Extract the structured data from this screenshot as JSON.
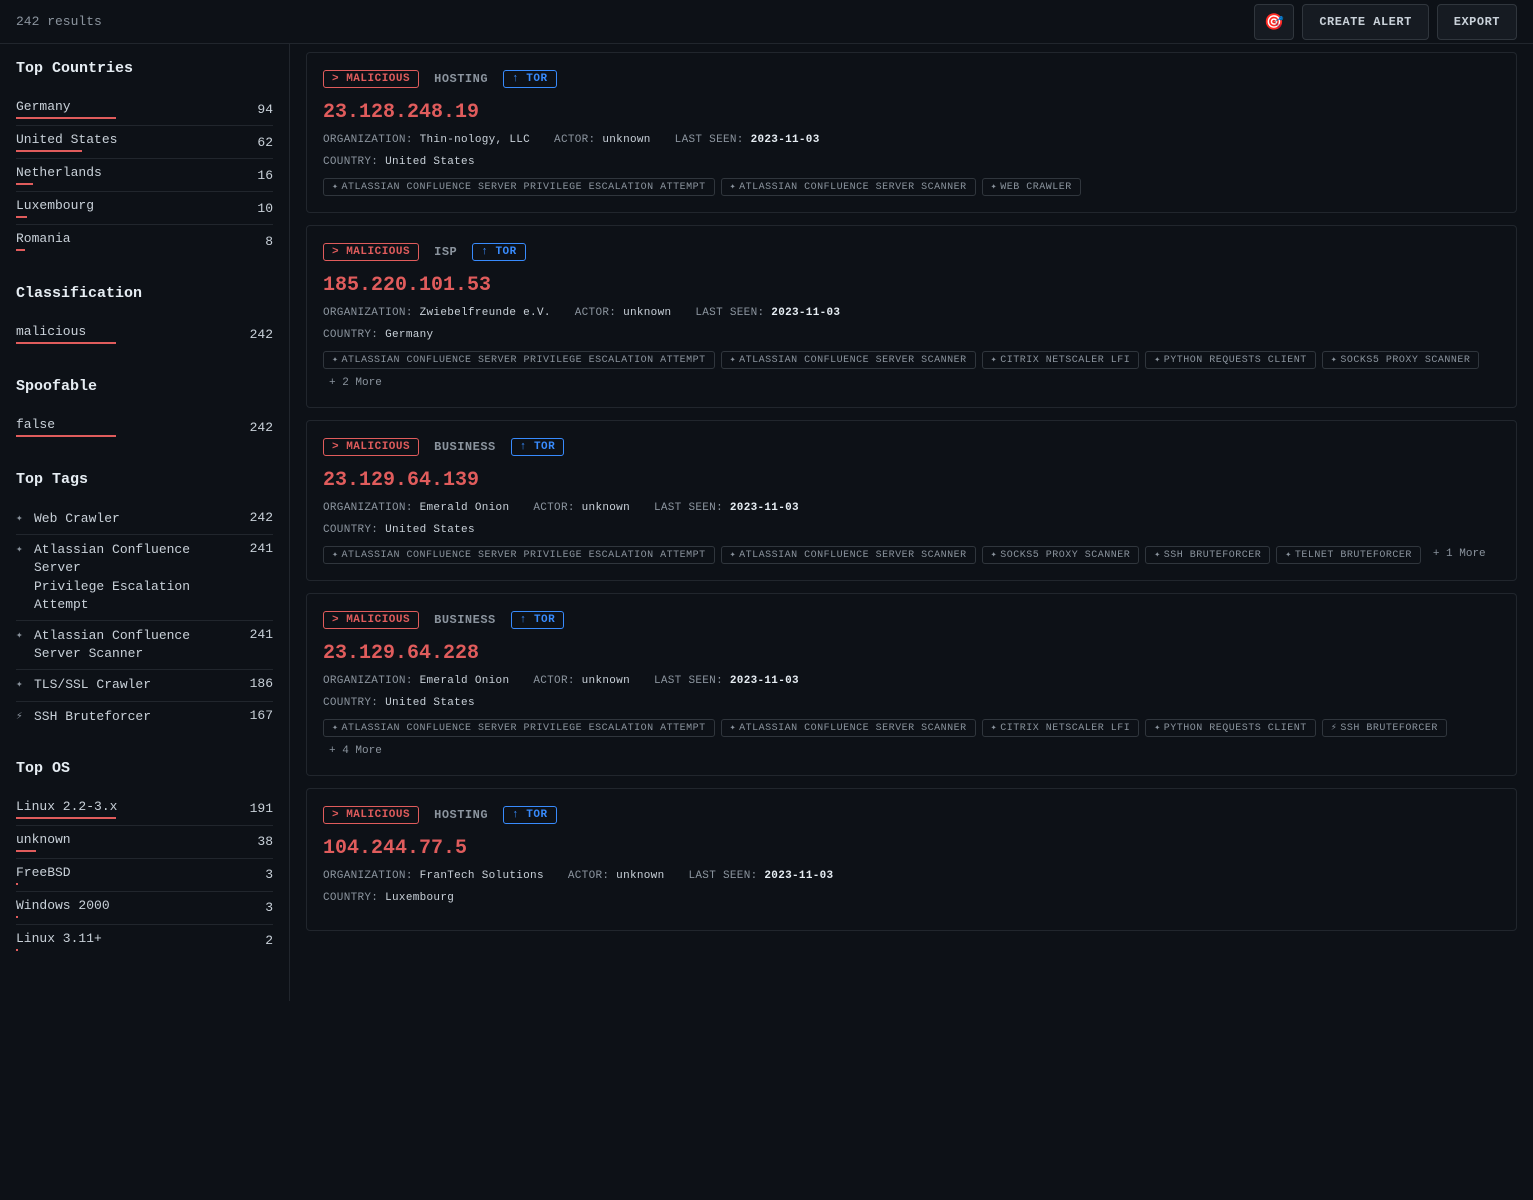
{
  "topbar": {
    "results_count": "242 results",
    "icon": "🎯",
    "create_alert_label": "CREATE ALERT",
    "export_label": "EXPORT"
  },
  "sidebar": {
    "top_countries_title": "Top Countries",
    "countries": [
      {
        "name": "Germany",
        "count": 94,
        "bar_pct": 100
      },
      {
        "name": "United States",
        "count": 62,
        "bar_pct": 66
      },
      {
        "name": "Netherlands",
        "count": 16,
        "bar_pct": 17
      },
      {
        "name": "Luxembourg",
        "count": 10,
        "bar_pct": 11
      },
      {
        "name": "Romania",
        "count": 8,
        "bar_pct": 9
      }
    ],
    "classification_title": "Classification",
    "classifications": [
      {
        "name": "malicious",
        "count": 242,
        "bar_pct": 100
      }
    ],
    "spoofable_title": "Spoofable",
    "spoofables": [
      {
        "name": "false",
        "count": 242,
        "bar_pct": 100
      }
    ],
    "top_tags_title": "Top Tags",
    "tags": [
      {
        "icon": "✦",
        "name": "Web Crawler",
        "count": 242
      },
      {
        "icon": "✦",
        "name": "Atlassian Confluence Server\nPrivilege Escalation Attempt",
        "count": 241
      },
      {
        "icon": "✦",
        "name": "Atlassian Confluence Server Scanner",
        "count": 241
      },
      {
        "icon": "✦",
        "name": "TLS/SSL Crawler",
        "count": 186
      },
      {
        "icon": "⚡",
        "name": "SSH Bruteforcer",
        "count": 167
      }
    ],
    "top_os_title": "Top OS",
    "os_list": [
      {
        "name": "Linux 2.2-3.x",
        "count": 191,
        "bar_pct": 100
      },
      {
        "name": "unknown",
        "count": 38,
        "bar_pct": 20
      },
      {
        "name": "FreeBSD",
        "count": 3,
        "bar_pct": 2
      },
      {
        "name": "Windows 2000",
        "count": 3,
        "bar_pct": 2
      },
      {
        "name": "Linux 3.11+",
        "count": 2,
        "bar_pct": 1
      }
    ]
  },
  "results": [
    {
      "badges": [
        "MALICIOUS",
        "HOSTING",
        "TOR"
      ],
      "ip": "23.128.248.19",
      "org": "Thin-nology, LLC",
      "actor": "unknown",
      "last_seen": "2023-11-03",
      "country": "United States",
      "tags": [
        {
          "icon": "✦",
          "label": "ATLASSIAN CONFLUENCE SERVER PRIVILEGE ESCALATION ATTEMPT"
        },
        {
          "icon": "✦",
          "label": "ATLASSIAN CONFLUENCE SERVER SCANNER"
        },
        {
          "icon": "✦",
          "label": "WEB CRAWLER"
        }
      ],
      "extra": null
    },
    {
      "badges": [
        "MALICIOUS",
        "ISP",
        "TOR"
      ],
      "ip": "185.220.101.53",
      "org": "Zwiebelfreunde e.V.",
      "actor": "unknown",
      "last_seen": "2023-11-03",
      "country": "Germany",
      "tags": [
        {
          "icon": "✦",
          "label": "ATLASSIAN CONFLUENCE SERVER PRIVILEGE ESCALATION ATTEMPT"
        },
        {
          "icon": "✦",
          "label": "ATLASSIAN CONFLUENCE SERVER SCANNER"
        },
        {
          "icon": "✦",
          "label": "CITRIX NETSCALER LFI"
        },
        {
          "icon": "✦",
          "label": "PYTHON REQUESTS CLIENT"
        },
        {
          "icon": "✦",
          "label": "SOCKS5 PROXY SCANNER"
        }
      ],
      "extra": "+ 2 More"
    },
    {
      "badges": [
        "MALICIOUS",
        "BUSINESS",
        "TOR"
      ],
      "ip": "23.129.64.139",
      "org": "Emerald Onion",
      "actor": "unknown",
      "last_seen": "2023-11-03",
      "country": "United States",
      "tags": [
        {
          "icon": "✦",
          "label": "ATLASSIAN CONFLUENCE SERVER PRIVILEGE ESCALATION ATTEMPT"
        },
        {
          "icon": "✦",
          "label": "ATLASSIAN CONFLUENCE SERVER SCANNER"
        },
        {
          "icon": "✦",
          "label": "SOCKS5 PROXY SCANNER"
        },
        {
          "icon": "✦",
          "label": "SSH BRUTEFORCER"
        },
        {
          "icon": "✦",
          "label": "TELNET BRUTEFORCER"
        }
      ],
      "extra": "+ 1 More"
    },
    {
      "badges": [
        "MALICIOUS",
        "BUSINESS",
        "TOR"
      ],
      "ip": "23.129.64.228",
      "org": "Emerald Onion",
      "actor": "unknown",
      "last_seen": "2023-11-03",
      "country": "United States",
      "tags": [
        {
          "icon": "✦",
          "label": "ATLASSIAN CONFLUENCE SERVER PRIVILEGE ESCALATION ATTEMPT"
        },
        {
          "icon": "✦",
          "label": "ATLASSIAN CONFLUENCE SERVER SCANNER"
        },
        {
          "icon": "✦",
          "label": "CITRIX NETSCALER LFI"
        },
        {
          "icon": "✦",
          "label": "PYTHON REQUESTS CLIENT"
        },
        {
          "icon": "⚡",
          "label": "SSH BRUTEFORCER"
        }
      ],
      "extra": "+ 4 More"
    },
    {
      "badges": [
        "MALICIOUS",
        "HOSTING",
        "TOR"
      ],
      "ip": "104.244.77.5",
      "org": "FranTech Solutions",
      "actor": "unknown",
      "last_seen": "2023-11-03",
      "country": "Luxembourg",
      "tags": [],
      "extra": null
    }
  ]
}
